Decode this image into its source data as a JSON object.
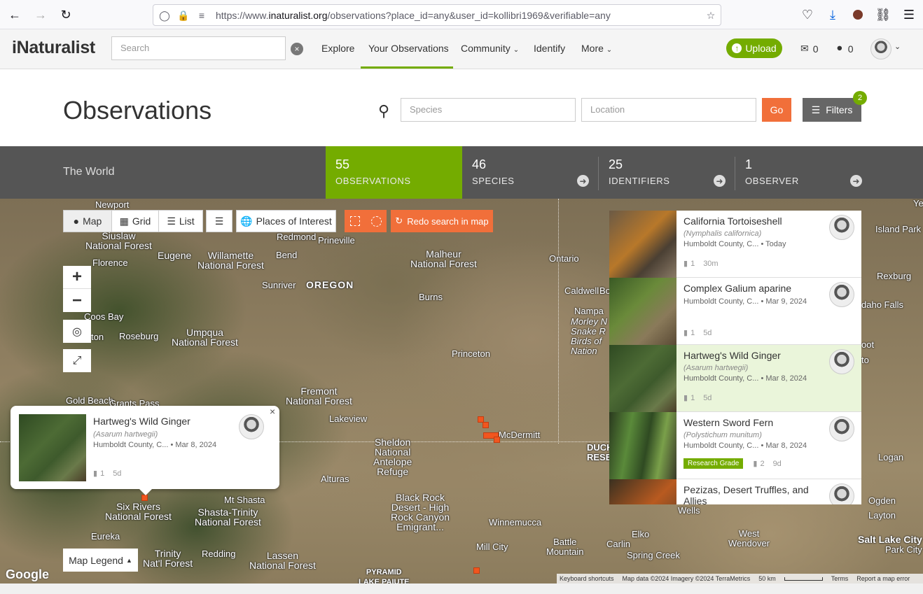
{
  "browser": {
    "url_host": "https://www.",
    "url_domain": "inaturalist.org",
    "url_path": "/observations?place_id=any&user_id=kollibri1969&verifiable=any"
  },
  "header": {
    "logo": "iNaturalist",
    "search_placeholder": "Search",
    "nav": {
      "explore": "Explore",
      "your_observations": "Your Observations",
      "community": "Community",
      "identify": "Identify",
      "more": "More"
    },
    "upload_label": "Upload",
    "messages_count": "0",
    "notifications_count": "0"
  },
  "title_row": {
    "title": "Observations",
    "species_placeholder": "Species",
    "location_placeholder": "Location",
    "go_label": "Go",
    "filters_label": "Filters",
    "filters_count": "2"
  },
  "stats": {
    "place": "The World",
    "observations": {
      "num": "55",
      "label": "OBSERVATIONS"
    },
    "species": {
      "num": "46",
      "label": "SPECIES"
    },
    "identifiers": {
      "num": "25",
      "label": "IDENTIFIERS"
    },
    "observers": {
      "num": "1",
      "label": "OBSERVER"
    }
  },
  "map_controls": {
    "map": "Map",
    "grid": "Grid",
    "list": "List",
    "places_of_interest": "Places of Interest",
    "redo_search": "Redo search in map",
    "legend": "Map Legend"
  },
  "map_labels": {
    "newport": "Newport",
    "siuslaw": "Siuslaw\nNational Forest",
    "florence": "Florence",
    "eugene": "Eugene",
    "willamette": "Willamette\nNational Forest",
    "redmond": "Redmond",
    "prineville": "Prineville",
    "bend": "Bend",
    "sunriver": "Sunriver",
    "oregon": "OREGON",
    "malheur": "Malheur\nNational Forest",
    "ontario": "Ontario",
    "caldwell": "Caldwell",
    "nampa": "Nampa",
    "burns": "Burns",
    "coos_bay": "Coos Bay",
    "roseburg": "Roseburg",
    "umpqua": "Umpqua\nNational Forest",
    "princeton": "Princeton",
    "gold_beach": "Gold Beach",
    "grants_pass": "Grants Pass",
    "fremont": "Fremont\nNational Forest",
    "lakeview": "Lakeview",
    "mcdermitt": "McDermitt",
    "sheldon": "Sheldon\nNational\nAntelope\nRefuge",
    "alturas": "Alturas",
    "black_rock": "Black Rock\nDesert - High\nRock Canyon\nEmigrant...",
    "six_rivers": "Six Rivers\nNational Forest",
    "mt_shasta": "Mt Shasta",
    "shasta_trinity": "Shasta-Trinity\nNational Forest",
    "eureka": "Eureka",
    "trinity": "Trinity\nNat'l Forest",
    "redding": "Redding",
    "lassen": "Lassen\nNational Forest",
    "winnemucca": "Winnemucca",
    "mill_city": "Mill City",
    "battle_mountain": "Battle\nMountain",
    "carlin": "Carlin",
    "elko": "Elko",
    "spring_creek": "Spring Creek",
    "west_wendover": "West\nWendover",
    "salt_lake": "Salt Lake City",
    "park_city": "Park City",
    "ogden": "Ogden",
    "layton": "Layton",
    "logan": "Logan",
    "wells": "Wells",
    "island_park": "Island Park",
    "rexburg": "Rexburg",
    "idaho_falls": "daho Falls",
    "pyramid": "PYRAMID\nLAKE PAIUTE",
    "duck": "DUCK\nRESE",
    "morley": "Morley N\nSnake R\nBirds of\nNation",
    "bo": "Bo",
    "ye": "Ye",
    "ton": "ton",
    "oot": "oot",
    "to": "to"
  },
  "popup": {
    "name": "Hartweg's Wild Ginger",
    "sci": "Asarum hartwegii",
    "place": "Humboldt County, C...",
    "date": "• Mar 8, 2024",
    "ids": "1",
    "age": "5d"
  },
  "side_list": [
    {
      "name": "California Tortoiseshell",
      "sci": "Nymphalis californica",
      "place": "Humboldt County, C...",
      "date": "• Today",
      "ids": "1",
      "age": "30m",
      "grade": ""
    },
    {
      "name": "Complex Galium aparine",
      "sci": "",
      "place": "Humboldt County, C...",
      "date": "• Mar 9, 2024",
      "ids": "1",
      "age": "5d",
      "grade": ""
    },
    {
      "name": "Hartweg's Wild Ginger",
      "sci": "Asarum hartwegii",
      "place": "Humboldt County, C...",
      "date": "• Mar 8, 2024",
      "ids": "1",
      "age": "5d",
      "grade": ""
    },
    {
      "name": "Western Sword Fern",
      "sci": "Polystichum munitum",
      "place": "Humboldt County, C...",
      "date": "• Mar 8, 2024",
      "ids": "2",
      "age": "9d",
      "grade": "Research Grade"
    },
    {
      "name": "Pezizas, Desert Truffles, and Allies",
      "sci": "",
      "place": "",
      "date": "",
      "ids": "",
      "age": "",
      "grade": ""
    }
  ],
  "attribution": {
    "keyboard": "Keyboard shortcuts",
    "mapdata": "Map data ©2024 Imagery ©2024 TerraMetrics",
    "scale": "50 km",
    "terms": "Terms",
    "report": "Report a map error",
    "google": "Google"
  },
  "colors": {
    "accent": "#74ac00",
    "orange": "#f16f3a",
    "stats_bg": "#555555"
  }
}
